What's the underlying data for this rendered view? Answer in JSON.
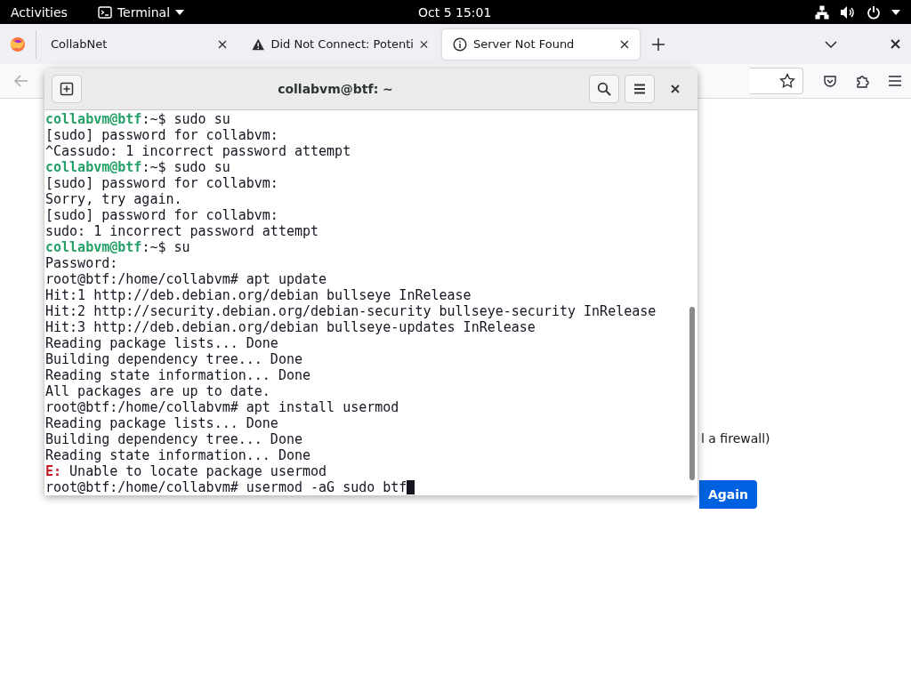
{
  "top_bar": {
    "activities": "Activities",
    "app_name": "Terminal",
    "clock": "Oct 5  15:01"
  },
  "browser": {
    "tabs": [
      {
        "label": "CollabNet",
        "selected": false
      },
      {
        "label": "Did Not Connect: Potenti",
        "selected": false
      },
      {
        "label": "Server Not Found",
        "selected": true
      }
    ],
    "page_text": "l a firewall)",
    "button_text": "Again"
  },
  "terminal": {
    "title": "collabvm@btf: ~",
    "cursor": true,
    "lines": [
      {
        "kind": "prompt",
        "user": "collabvm@btf",
        "rest": ":~$ sudo su"
      },
      {
        "kind": "output",
        "text": "[sudo] password for collabvm:"
      },
      {
        "kind": "output",
        "text": "^Cassudo: 1 incorrect password attempt"
      },
      {
        "kind": "prompt",
        "user": "collabvm@btf",
        "rest": ":~$ sudo su"
      },
      {
        "kind": "output",
        "text": "[sudo] password for collabvm:"
      },
      {
        "kind": "output",
        "text": "Sorry, try again."
      },
      {
        "kind": "output",
        "text": "[sudo] password for collabvm:"
      },
      {
        "kind": "output",
        "text": "sudo: 1 incorrect password attempt"
      },
      {
        "kind": "prompt",
        "user": "collabvm@btf",
        "rest": ":~$ su"
      },
      {
        "kind": "output",
        "text": "Password:"
      },
      {
        "kind": "output",
        "text": "root@btf:/home/collabvm# apt update"
      },
      {
        "kind": "output",
        "text": "Hit:1 http://deb.debian.org/debian bullseye InRelease"
      },
      {
        "kind": "output",
        "text": "Hit:2 http://security.debian.org/debian-security bullseye-security InRelease"
      },
      {
        "kind": "output",
        "text": "Hit:3 http://deb.debian.org/debian bullseye-updates InRelease"
      },
      {
        "kind": "output",
        "text": "Reading package lists... Done"
      },
      {
        "kind": "output",
        "text": "Building dependency tree... Done"
      },
      {
        "kind": "output",
        "text": "Reading state information... Done"
      },
      {
        "kind": "output",
        "text": "All packages are up to date."
      },
      {
        "kind": "output",
        "text": "root@btf:/home/collabvm# apt install usermod"
      },
      {
        "kind": "output",
        "text": "Reading package lists... Done"
      },
      {
        "kind": "output",
        "text": "Building dependency tree... Done"
      },
      {
        "kind": "output",
        "text": "Reading state information... Done"
      },
      {
        "kind": "error",
        "label": "E:",
        "text": " Unable to locate package usermod"
      },
      {
        "kind": "output",
        "text": "root@btf:/home/collabvm# usermod -aG sudo btf"
      }
    ]
  }
}
